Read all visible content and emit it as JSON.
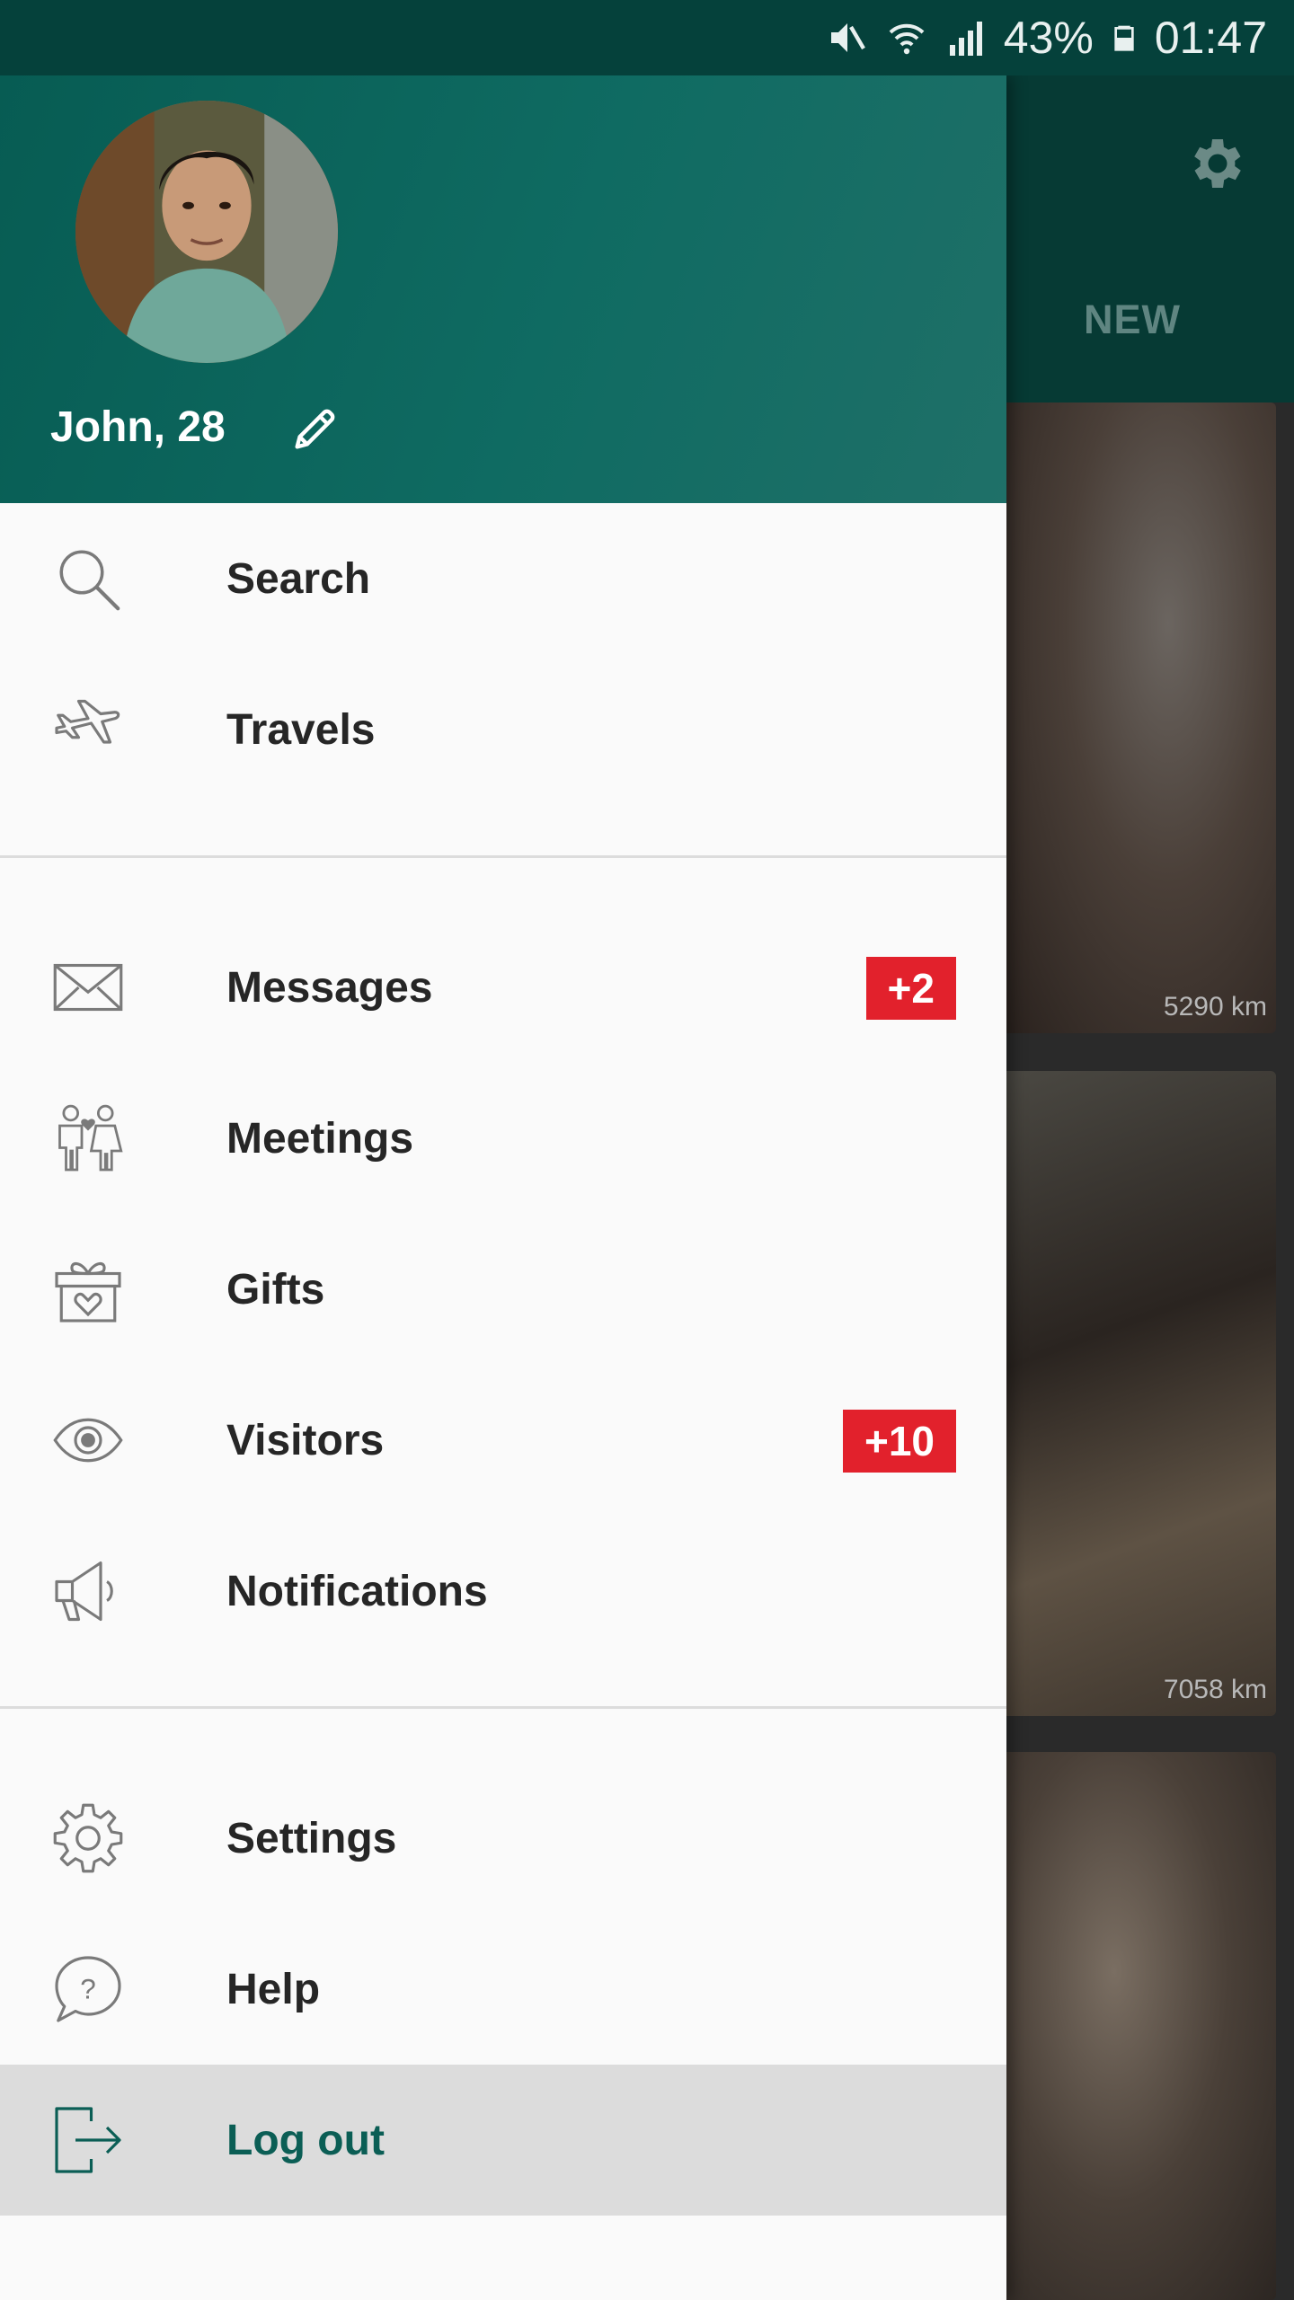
{
  "status_bar": {
    "battery": "43%",
    "time": "01:47",
    "icons": [
      "mute-icon",
      "wifi-icon",
      "signal-icon",
      "battery-icon"
    ]
  },
  "background": {
    "tab_new": "NEW",
    "settings_icon": "gear-icon",
    "photos": [
      {
        "distance": "5290 km"
      },
      {
        "distance": "7058 km"
      },
      {
        "distance": ""
      }
    ]
  },
  "profile": {
    "name": "John, 28",
    "edit_icon": "pencil-icon"
  },
  "menu": {
    "search": {
      "label": "Search",
      "icon": "search-icon"
    },
    "travels": {
      "label": "Travels",
      "icon": "airplane-icon"
    },
    "messages": {
      "label": "Messages",
      "icon": "envelope-icon",
      "badge": "+2"
    },
    "meetings": {
      "label": "Meetings",
      "icon": "couple-icon"
    },
    "gifts": {
      "label": "Gifts",
      "icon": "gift-icon"
    },
    "visitors": {
      "label": "Visitors",
      "icon": "eye-icon",
      "badge": "+10"
    },
    "notifications": {
      "label": "Notifications",
      "icon": "megaphone-icon"
    },
    "settings": {
      "label": "Settings",
      "icon": "gear-icon"
    },
    "help": {
      "label": "Help",
      "icon": "help-bubble-icon"
    },
    "logout": {
      "label": "Log out",
      "icon": "logout-icon"
    }
  },
  "colors": {
    "header": "#075c53",
    "status_bar": "#05413b",
    "badge": "#e2212c",
    "accent": "#0b5e55"
  }
}
